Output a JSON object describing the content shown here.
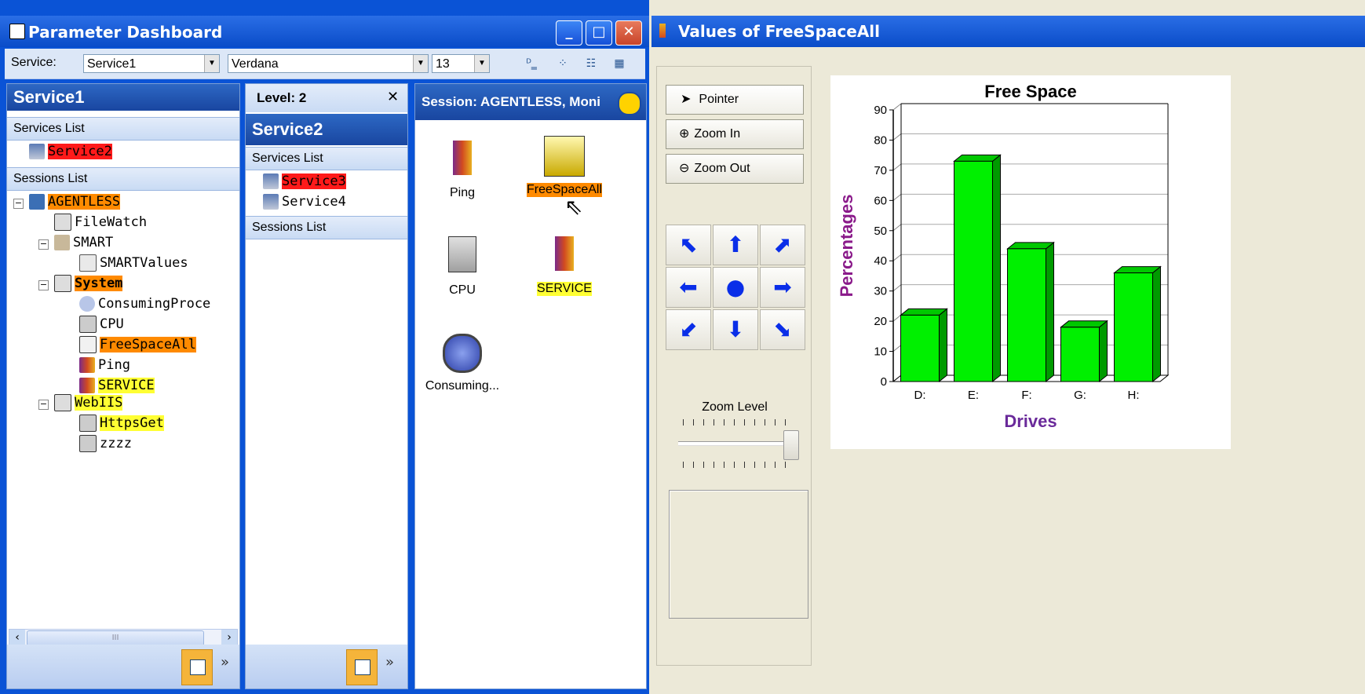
{
  "left_window": {
    "title": "Parameter Dashboard",
    "buttons": [
      "_",
      "□",
      "✕"
    ]
  },
  "toolbar": {
    "service_label": "Service:",
    "service_value": "Service1",
    "font_value": "Verdana",
    "size_value": "13"
  },
  "pane1": {
    "title": "Service1",
    "services_list_label": "Services List",
    "services": [
      "Service2"
    ],
    "sessions_list_label": "Sessions List",
    "scroll_thumb": "III",
    "tree": [
      {
        "label": "AGENTLESS",
        "highlight": "orange"
      },
      {
        "label": "FileWatch",
        "highlight": "none"
      },
      {
        "label": "SMART",
        "highlight": "none"
      },
      {
        "label": "SMARTValues",
        "highlight": "none"
      },
      {
        "label": "System",
        "highlight": "orange"
      },
      {
        "label": "ConsumingProce",
        "highlight": "none"
      },
      {
        "label": "CPU",
        "highlight": "none"
      },
      {
        "label": "FreeSpaceAll",
        "highlight": "orange"
      },
      {
        "label": "Ping",
        "highlight": "none"
      },
      {
        "label": "SERVICE",
        "highlight": "yellow"
      },
      {
        "label": "WebIIS",
        "highlight": "yellow"
      },
      {
        "label": "HttpsGet",
        "highlight": "yellow"
      },
      {
        "label": "zzzz",
        "highlight": "none"
      }
    ]
  },
  "pane2": {
    "level_label": "Level: 2",
    "close": "✕",
    "title": "Service2",
    "services_list_label": "Services List",
    "services": [
      {
        "label": "Service3",
        "highlight": "red"
      },
      {
        "label": "Service4",
        "highlight": "none"
      }
    ],
    "sessions_list_label": "Sessions List"
  },
  "pane3": {
    "title": "Session: AGENTLESS, Moni",
    "icons": [
      {
        "label": "Ping",
        "highlight": "none"
      },
      {
        "label": "FreeSpaceAll",
        "highlight": "orange"
      },
      {
        "label": "CPU",
        "highlight": "none"
      },
      {
        "label": "SERVICE",
        "highlight": "yellow"
      },
      {
        "label": "Consuming...",
        "highlight": "none"
      }
    ]
  },
  "right_window": {
    "title": "Values of FreeSpaceAll",
    "pointer_label": "Pointer",
    "zoom_in_label": "Zoom In",
    "zoom_out_label": "Zoom Out",
    "zoom_level_label": "Zoom Level",
    "zoom_level_value": 1.0
  },
  "chart_data": {
    "type": "bar",
    "title": "Free Space",
    "xlabel": "Drives",
    "ylabel": "Percentages",
    "categories": [
      "D:",
      "E:",
      "F:",
      "G:",
      "H:"
    ],
    "values": [
      22,
      73,
      44,
      18,
      36
    ],
    "ylim": [
      0,
      90
    ],
    "yticks": [
      0,
      10,
      20,
      30,
      40,
      50,
      60,
      70,
      80,
      90
    ],
    "bar_color": "#00f000",
    "grid": true
  },
  "colors": {
    "title_bar": "#0a4cc8",
    "pane_header": "#1946a0",
    "highlight_red": "#ff1a1a",
    "highlight_orange": "#ff8a00",
    "highlight_yellow": "#ffff33",
    "nav_arrow": "#0a2ee8"
  }
}
